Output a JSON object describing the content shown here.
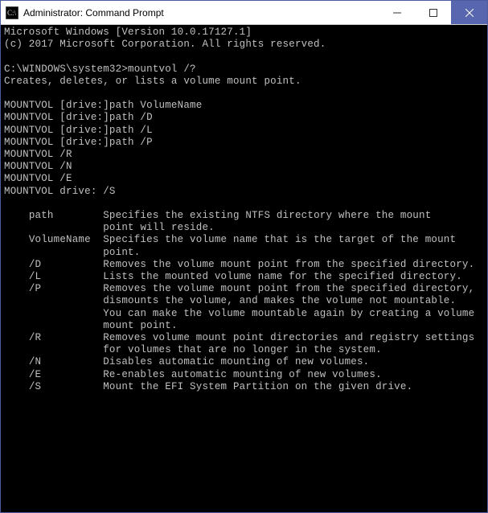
{
  "window": {
    "title": "Administrator: Command Prompt"
  },
  "terminal": {
    "lines": [
      "Microsoft Windows [Version 10.0.17127.1]",
      "(c) 2017 Microsoft Corporation. All rights reserved.",
      "",
      "C:\\WINDOWS\\system32>mountvol /?",
      "Creates, deletes, or lists a volume mount point.",
      "",
      "MOUNTVOL [drive:]path VolumeName",
      "MOUNTVOL [drive:]path /D",
      "MOUNTVOL [drive:]path /L",
      "MOUNTVOL [drive:]path /P",
      "MOUNTVOL /R",
      "MOUNTVOL /N",
      "MOUNTVOL /E",
      "MOUNTVOL drive: /S",
      "",
      "    path        Specifies the existing NTFS directory where the mount",
      "                point will reside.",
      "    VolumeName  Specifies the volume name that is the target of the mount",
      "                point.",
      "    /D          Removes the volume mount point from the specified directory.",
      "    /L          Lists the mounted volume name for the specified directory.",
      "    /P          Removes the volume mount point from the specified directory,",
      "                dismounts the volume, and makes the volume not mountable.",
      "                You can make the volume mountable again by creating a volume",
      "                mount point.",
      "    /R          Removes volume mount point directories and registry settings",
      "                for volumes that are no longer in the system.",
      "    /N          Disables automatic mounting of new volumes.",
      "    /E          Re-enables automatic mounting of new volumes.",
      "    /S          Mount the EFI System Partition on the given drive."
    ]
  }
}
